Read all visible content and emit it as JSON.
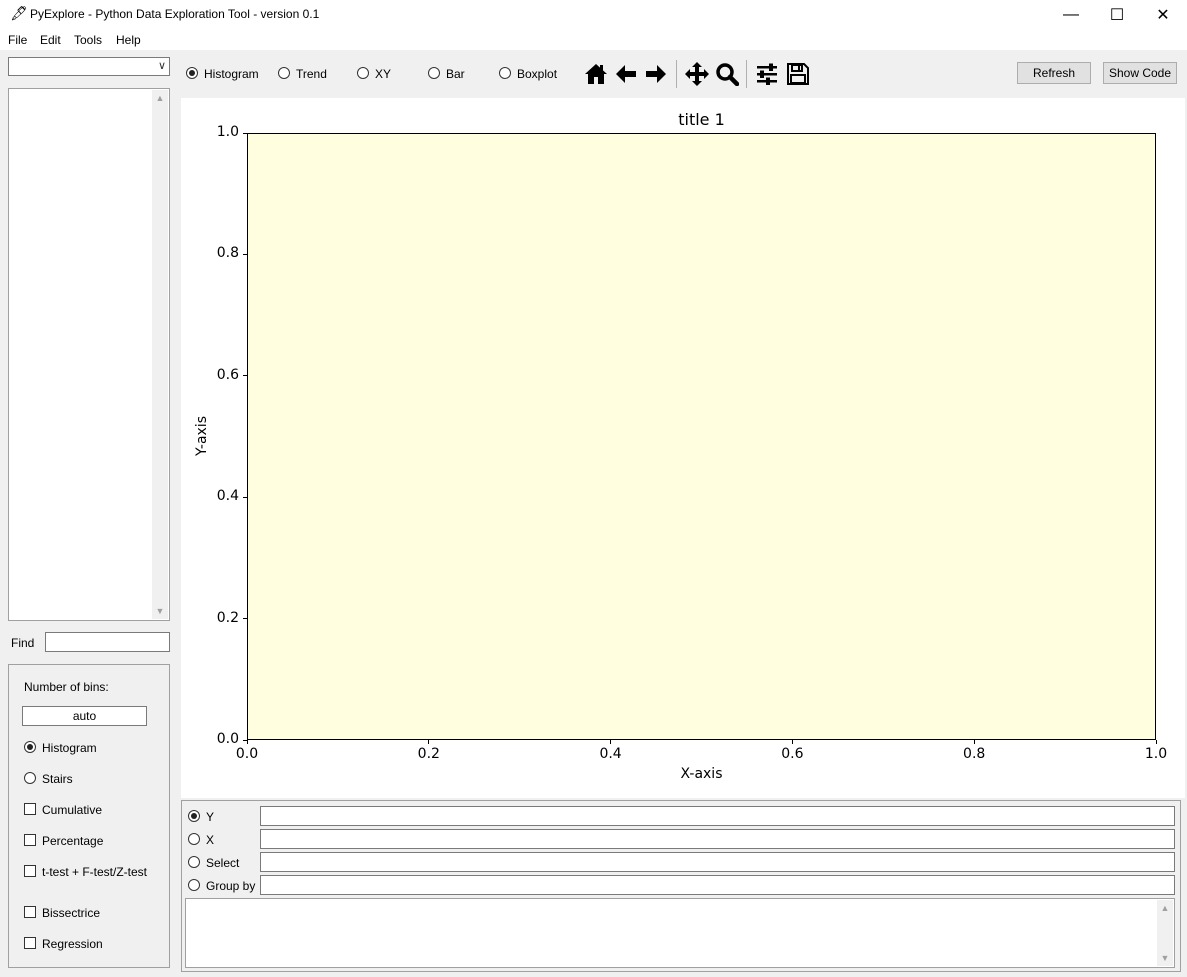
{
  "window": {
    "title": "PyExplore - Python Data Exploration Tool - version 0.1",
    "minimize_glyph": "—",
    "maximize_glyph": "☐",
    "close_glyph": "✕"
  },
  "menu": [
    "File",
    "Edit",
    "Tools",
    "Help"
  ],
  "left_panel": {
    "combo_value": "",
    "find_label": "Find",
    "find_value": "",
    "options": {
      "bins_label": "Number of bins:",
      "bins_value": "auto",
      "histogram_label": "Histogram",
      "stairs_label": "Stairs",
      "cumulative_label": "Cumulative",
      "percentage_label": "Percentage",
      "ttest_label": "t-test + F-test/Z-test",
      "bissectrice_label": "Bissectrice",
      "regression_label": "Regression",
      "selected_mode": "Histogram"
    }
  },
  "toolbar": {
    "plot_types": [
      "Histogram",
      "Trend",
      "XY",
      "Bar",
      "Boxplot"
    ],
    "selected_plot_type": "Histogram",
    "nav_icons": [
      "home-icon",
      "back-arrow-icon",
      "forward-arrow-icon",
      "pan-icon",
      "zoom-icon",
      "configure-subplots-icon",
      "save-icon"
    ],
    "refresh_label": "Refresh",
    "show_code_label": "Show Code"
  },
  "chart_data": {
    "type": "histogram",
    "title": "title 1",
    "xlabel": "X-axis",
    "ylabel": "Y-axis",
    "xlim": [
      0.0,
      1.0
    ],
    "ylim": [
      0.0,
      1.0
    ],
    "xticks": [
      "0.0",
      "0.2",
      "0.4",
      "0.6",
      "0.8",
      "1.0"
    ],
    "yticks": [
      "0.0",
      "0.2",
      "0.4",
      "0.6",
      "0.8",
      "1.0"
    ],
    "values": [],
    "plot_background": "#ffffe0",
    "grid": false
  },
  "query": {
    "y_label": "Y",
    "x_label": "X",
    "select_label": "Select",
    "groupby_label": "Group by",
    "selected": "Y",
    "y_value": "",
    "x_value": "",
    "select_value": "",
    "groupby_value": "",
    "code_text": ""
  }
}
